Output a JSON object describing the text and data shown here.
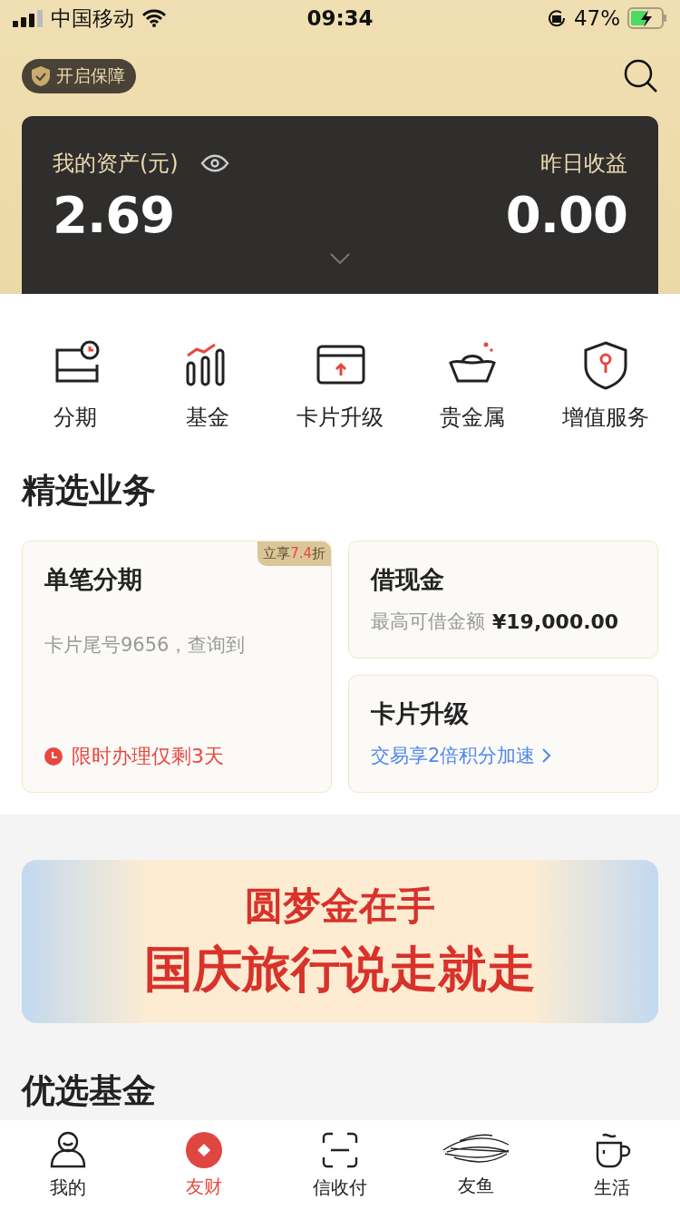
{
  "status_bar": {
    "carrier": "中国移动",
    "time": "09:34",
    "battery": "47%"
  },
  "header": {
    "protect_button": "开启保障"
  },
  "assets": {
    "label": "我的资产(元)",
    "value": "2.69",
    "yesterday_label": "昨日收益",
    "yesterday_value": "0.00"
  },
  "shortcuts": [
    {
      "kind": "installment",
      "label": "分期"
    },
    {
      "kind": "fund",
      "label": "基金"
    },
    {
      "kind": "card",
      "label": "卡片升级"
    },
    {
      "kind": "gold",
      "label": "贵金属"
    },
    {
      "kind": "shield",
      "label": "增值服务"
    }
  ],
  "featured": {
    "title": "精选业务",
    "main_card": {
      "title": "单笔分期",
      "tag_before": "立享",
      "tag_highlight": "7.4",
      "tag_after": "折",
      "subtitle": "卡片尾号9656，查询到",
      "notice": "限时办理仅剩3天"
    },
    "cash_card": {
      "title": "借现金",
      "label": "最高可借金额",
      "amount": "¥19,000.00"
    },
    "upgrade_card": {
      "title": "卡片升级",
      "link": "交易享2倍积分加速"
    }
  },
  "banner": {
    "line_1": "圆梦金在手",
    "line_2": "国庆旅行说走就走"
  },
  "fund_section": {
    "title": "优选基金"
  },
  "tab_bar": [
    {
      "kind": "person",
      "label": "我的",
      "selected": false
    },
    {
      "kind": "coin",
      "label": "友财",
      "selected": true
    },
    {
      "kind": "scan",
      "label": "信收付",
      "selected": false
    },
    {
      "kind": "fish",
      "label": "友鱼",
      "selected": false
    },
    {
      "kind": "cup",
      "label": "生活",
      "selected": false
    }
  ]
}
